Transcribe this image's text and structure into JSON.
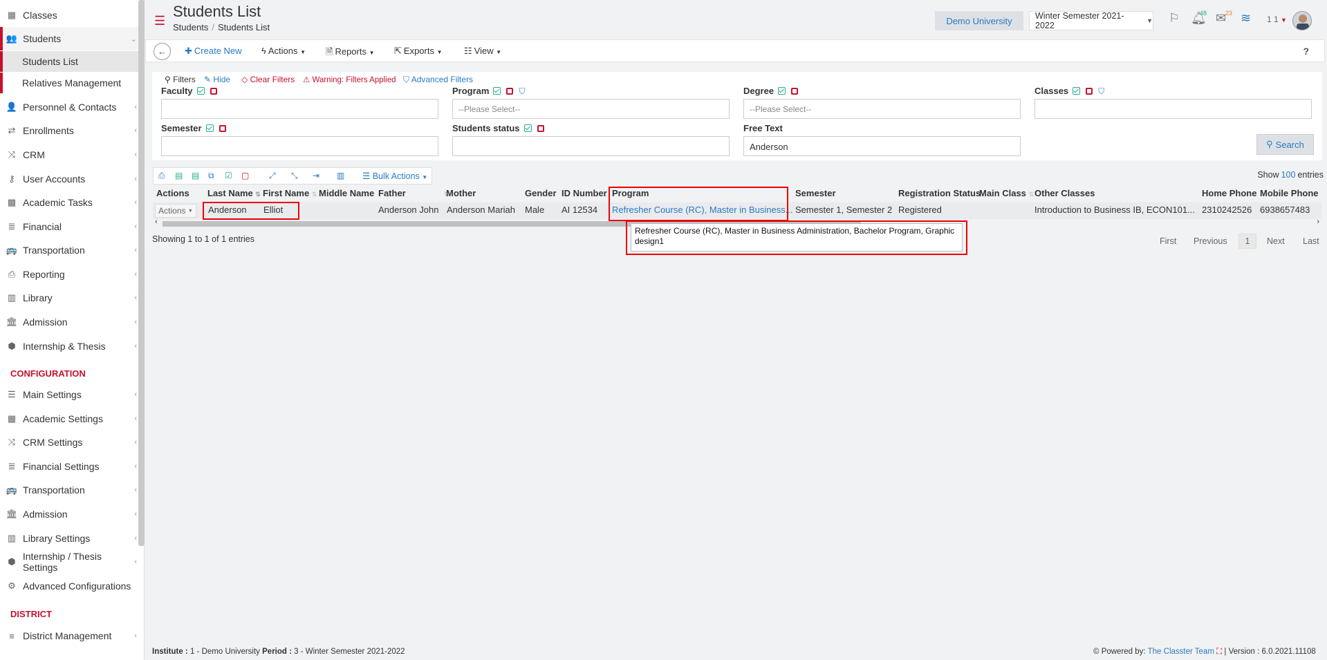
{
  "sidebar": {
    "items": [
      {
        "label": "Classes",
        "icon": "classes-icon"
      },
      {
        "label": "Students",
        "icon": "students-icon"
      },
      {
        "label": "Students List"
      },
      {
        "label": "Relatives Management"
      },
      {
        "label": "Personnel & Contacts",
        "icon": "person-icon"
      },
      {
        "label": "Enrollments",
        "icon": "arrows-icon"
      },
      {
        "label": "CRM",
        "icon": "shuffle-icon"
      },
      {
        "label": "User Accounts",
        "icon": "key-icon"
      },
      {
        "label": "Academic Tasks",
        "icon": "grid-icon"
      },
      {
        "label": "Financial",
        "icon": "coins-icon"
      },
      {
        "label": "Transportation",
        "icon": "bus-icon"
      },
      {
        "label": "Reporting",
        "icon": "printer-icon"
      },
      {
        "label": "Library",
        "icon": "books-icon"
      },
      {
        "label": "Admission",
        "icon": "bank-icon"
      },
      {
        "label": "Internship & Thesis",
        "icon": "cube-icon"
      }
    ],
    "config_title": "CONFIGURATION",
    "config_items": [
      {
        "label": "Main Settings",
        "icon": "sliders-icon"
      },
      {
        "label": "Academic Settings",
        "icon": "classes-icon"
      },
      {
        "label": "CRM Settings",
        "icon": "shuffle-icon"
      },
      {
        "label": "Financial Settings",
        "icon": "coins-icon"
      },
      {
        "label": "Transportation",
        "icon": "bus-icon"
      },
      {
        "label": "Admission",
        "icon": "bank-icon"
      },
      {
        "label": "Library Settings",
        "icon": "books-icon"
      },
      {
        "label": "Internship / Thesis Settings",
        "icon": "cube-icon"
      },
      {
        "label": "Advanced Configurations",
        "icon": "gears-icon"
      }
    ],
    "district_title": "DISTRICT",
    "district_items": [
      {
        "label": "District Management",
        "icon": "list-icon"
      }
    ]
  },
  "header": {
    "title": "Students List",
    "breadcrumb": [
      "Students",
      "Students List"
    ],
    "university": "Demo University",
    "semester": "Winter Semester 2021-2022",
    "notif_count": "48",
    "msg_count": "23",
    "user_num": "1 1"
  },
  "toolbar": {
    "create": "Create New",
    "actions": "Actions",
    "reports": "Reports",
    "exports": "Exports",
    "view": "View",
    "help": "?"
  },
  "filters": {
    "title": "Filters",
    "hide": "Hide",
    "clear": "Clear Filters",
    "warning": "Warning: Filters Applied",
    "advanced": "Advanced Filters",
    "faculty": "Faculty",
    "program": "Program",
    "degree": "Degree",
    "classes": "Classes",
    "semester": "Semester",
    "students_status": "Students status",
    "free_text": "Free Text",
    "please_select": "--Please Select--",
    "free_text_value": "Anderson",
    "search": "Search"
  },
  "table": {
    "bulk": "Bulk Actions",
    "show": "Show",
    "entries_n": "100",
    "entries": "entries",
    "columns": [
      "Actions",
      "Last Name",
      "First Name",
      "Middle Name",
      "Father",
      "Mother",
      "Gender",
      "ID Number",
      "Program",
      "Semester",
      "Registration Status",
      "Main Class",
      "Other Classes",
      "Home Phone",
      "Mobile Phone"
    ],
    "row": {
      "actions": "Actions",
      "last_name": "Anderson",
      "first_name": "Elliot",
      "middle_name": "",
      "father": "Anderson John",
      "mother": "Anderson Mariah",
      "gender": "Male",
      "id_number": "AI 12534",
      "program": "Refresher Course (RC), Master in Business...",
      "semester": "Semester 1, Semester 2",
      "registration_status": "Registered",
      "main_class": "",
      "other_classes": "Introduction to Business IB, ECON101...",
      "home_phone": "2310242526",
      "mobile_phone": "6938657483"
    },
    "showing": "Showing 1 to 1 of 1 entries",
    "pagination": {
      "first": "First",
      "previous": "Previous",
      "current": "1",
      "next": "Next",
      "last": "Last"
    },
    "tooltip": "Refresher Course (RC), Master in Business Administration, Bachelor Program, Graphic design1"
  },
  "footer": {
    "institute_label": "Institute :",
    "institute_value": "1 - Demo University",
    "period_label": "Period :",
    "period_value": "3 - Winter Semester 2021-2022",
    "powered": "Powered by:",
    "team": "The Classter Team",
    "version": "| Version : 6.0.2021.11108"
  },
  "colors": {
    "accent": "#c8102e",
    "link": "#2a7ac0",
    "highlight": "#ee0000",
    "check": "#27ae8f"
  }
}
